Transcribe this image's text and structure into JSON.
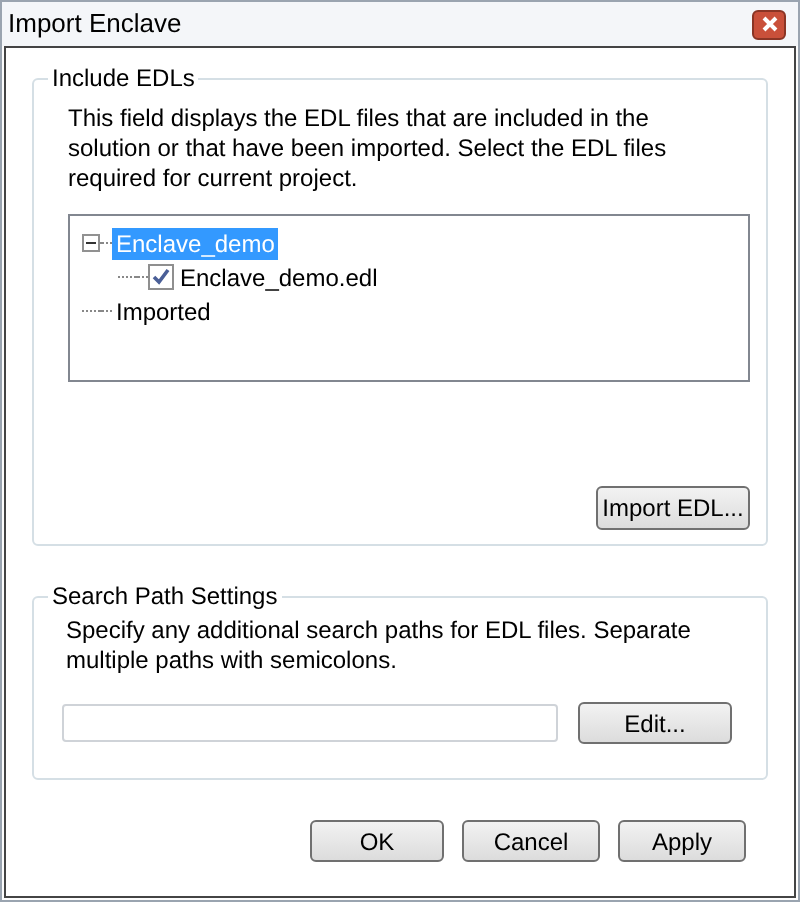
{
  "window": {
    "title": "Import Enclave"
  },
  "include_group": {
    "title": "Include EDLs",
    "description": "This field displays the EDL files that are included in the solution or that have been imported. Select the EDL files required for current project.",
    "tree": [
      {
        "label": "Enclave_demo",
        "selected": true,
        "expanded": true,
        "children": [
          {
            "label": "Enclave_demo.edl",
            "selected": false,
            "checked": true
          }
        ]
      },
      {
        "label": "Imported",
        "selected": false
      }
    ],
    "button": "Import EDL..."
  },
  "search_group": {
    "title": "Search Path Settings",
    "description": "Specify any additional search paths for EDL files. Separate multiple paths with semicolons.",
    "button": "Edit..."
  },
  "buttons": [
    "OK",
    "Cancel",
    "Apply"
  ]
}
